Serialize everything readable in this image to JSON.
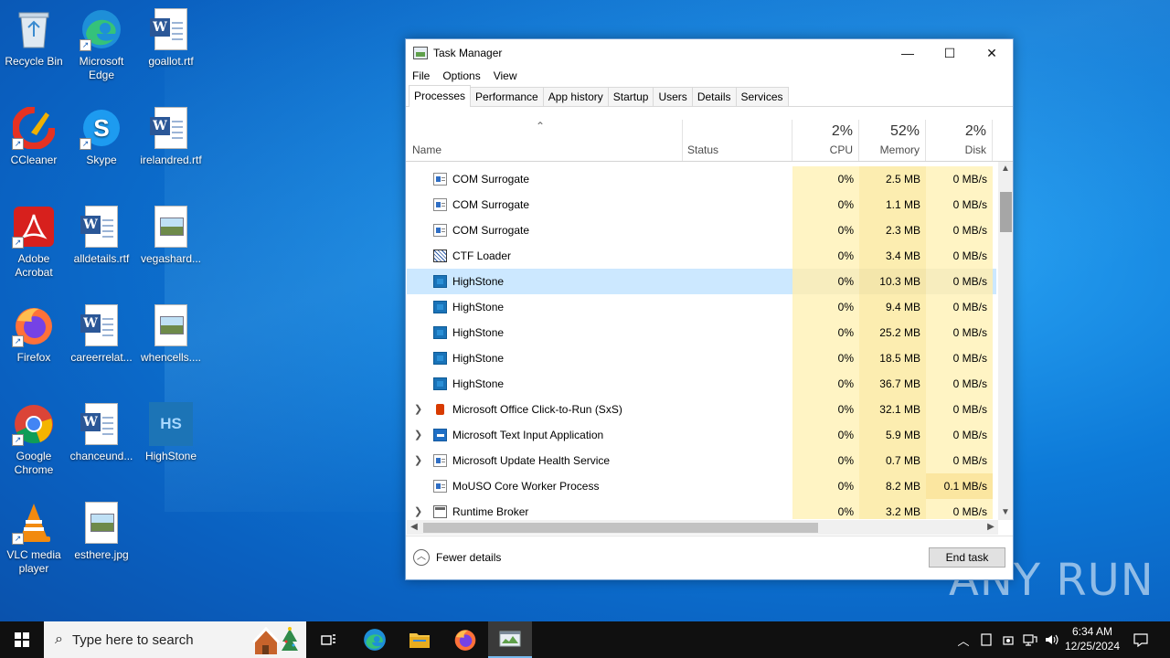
{
  "desktop": {
    "icons": [
      {
        "label": "Recycle Bin",
        "icon": "recycle-bin-icon"
      },
      {
        "label": "Microsoft Edge",
        "icon": "edge-icon"
      },
      {
        "label": "goallot.rtf",
        "icon": "word-doc-icon"
      },
      {
        "label": "CCleaner",
        "icon": "ccleaner-icon"
      },
      {
        "label": "Skype",
        "icon": "skype-icon"
      },
      {
        "label": "irelandred.rtf",
        "icon": "word-doc-icon"
      },
      {
        "label": "Adobe Acrobat",
        "icon": "acrobat-icon"
      },
      {
        "label": "alldetails.rtf",
        "icon": "word-doc-icon"
      },
      {
        "label": "vegashard...",
        "icon": "image-file-icon"
      },
      {
        "label": "Firefox",
        "icon": "firefox-icon"
      },
      {
        "label": "careerrelat...",
        "icon": "word-doc-icon"
      },
      {
        "label": "whencells....",
        "icon": "image-file-icon"
      },
      {
        "label": "Google Chrome",
        "icon": "chrome-icon"
      },
      {
        "label": "chanceund...",
        "icon": "word-doc-icon"
      },
      {
        "label": "HighStone",
        "icon": "highstone-icon"
      },
      {
        "label": "VLC media player",
        "icon": "vlc-icon"
      },
      {
        "label": "esthere.jpg",
        "icon": "image-file-icon"
      }
    ],
    "highstone_badge": "HS",
    "watermark": "ANY RUN"
  },
  "taskmanager": {
    "title": "Task Manager",
    "menu": [
      "File",
      "Options",
      "View"
    ],
    "tabs": [
      "Processes",
      "Performance",
      "App history",
      "Startup",
      "Users",
      "Details",
      "Services"
    ],
    "active_tab": "Processes",
    "columns": {
      "name": "Name",
      "status": "Status",
      "cpu": {
        "pct": "2%",
        "label": "CPU"
      },
      "memory": {
        "pct": "52%",
        "label": "Memory"
      },
      "disk": {
        "pct": "2%",
        "label": "Disk"
      }
    },
    "processes": [
      {
        "name": "COM Surrogate",
        "icon": "com-surrogate-icon",
        "expandable": false,
        "cpu": "0%",
        "memory": "2.5 MB",
        "disk": "0 MB/s"
      },
      {
        "name": "COM Surrogate",
        "icon": "com-surrogate-icon",
        "expandable": false,
        "cpu": "0%",
        "memory": "1.1 MB",
        "disk": "0 MB/s"
      },
      {
        "name": "COM Surrogate",
        "icon": "com-surrogate-icon",
        "expandable": false,
        "cpu": "0%",
        "memory": "2.3 MB",
        "disk": "0 MB/s"
      },
      {
        "name": "CTF Loader",
        "icon": "ctf-loader-icon",
        "expandable": false,
        "cpu": "0%",
        "memory": "3.4 MB",
        "disk": "0 MB/s"
      },
      {
        "name": "HighStone",
        "icon": "highstone-icon",
        "expandable": false,
        "cpu": "0%",
        "memory": "10.3 MB",
        "disk": "0 MB/s",
        "selected": true
      },
      {
        "name": "HighStone",
        "icon": "highstone-icon",
        "expandable": false,
        "cpu": "0%",
        "memory": "9.4 MB",
        "disk": "0 MB/s"
      },
      {
        "name": "HighStone",
        "icon": "highstone-icon",
        "expandable": false,
        "cpu": "0%",
        "memory": "25.2 MB",
        "disk": "0 MB/s"
      },
      {
        "name": "HighStone",
        "icon": "highstone-icon",
        "expandable": false,
        "cpu": "0%",
        "memory": "18.5 MB",
        "disk": "0 MB/s"
      },
      {
        "name": "HighStone",
        "icon": "highstone-icon",
        "expandable": false,
        "cpu": "0%",
        "memory": "36.7 MB",
        "disk": "0 MB/s"
      },
      {
        "name": "Microsoft Office Click-to-Run (SxS)",
        "icon": "office-icon",
        "expandable": true,
        "cpu": "0%",
        "memory": "32.1 MB",
        "disk": "0 MB/s"
      },
      {
        "name": "Microsoft Text Input Application",
        "icon": "text-input-icon",
        "expandable": true,
        "cpu": "0%",
        "memory": "5.9 MB",
        "disk": "0 MB/s"
      },
      {
        "name": "Microsoft Update Health Service",
        "icon": "com-surrogate-icon",
        "expandable": true,
        "cpu": "0%",
        "memory": "0.7 MB",
        "disk": "0 MB/s"
      },
      {
        "name": "MoUSO Core Worker Process",
        "icon": "com-surrogate-icon",
        "expandable": false,
        "cpu": "0%",
        "memory": "8.2 MB",
        "disk": "0.1 MB/s"
      },
      {
        "name": "Runtime Broker",
        "icon": "runtime-broker-icon",
        "expandable": true,
        "cpu": "0%",
        "memory": "3.2 MB",
        "disk": "0 MB/s"
      }
    ],
    "fewer_details": "Fewer details",
    "end_task": "End task"
  },
  "taskbar": {
    "search_placeholder": "Type here to search",
    "time": "6:34 AM",
    "date": "12/25/2024"
  }
}
